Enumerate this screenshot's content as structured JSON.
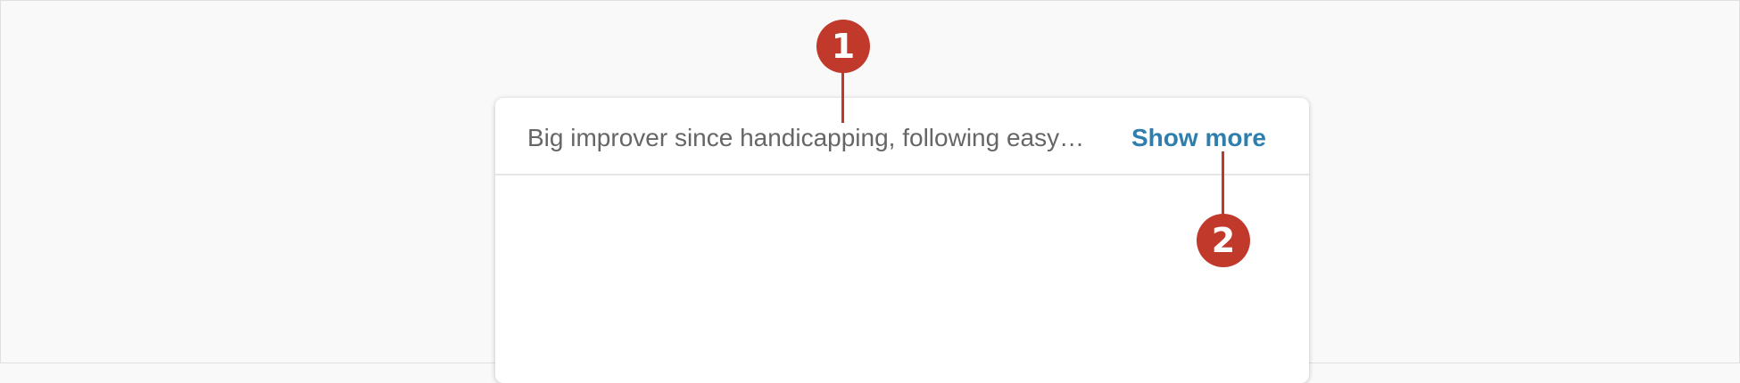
{
  "card": {
    "preview_text": "Big improver since handicapping, following easy…",
    "show_more_label": "Show more"
  },
  "callouts": [
    {
      "label": "1",
      "target": "preview-text"
    },
    {
      "label": "2",
      "target": "show-more-link"
    }
  ],
  "colors": {
    "accent_link": "#2e7fad",
    "callout": "#c0392b",
    "text_muted": "#666666",
    "background": "#f9f9f9"
  }
}
